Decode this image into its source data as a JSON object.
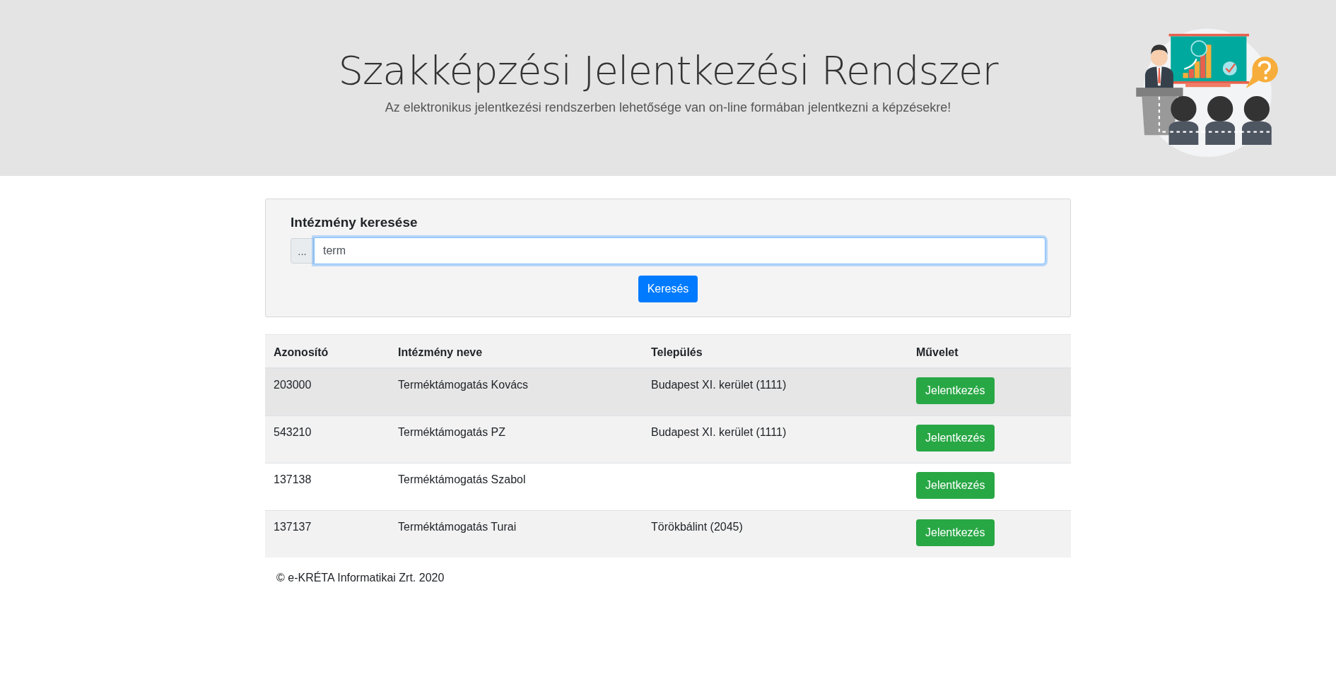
{
  "header": {
    "title": "Szakképzési Jelentkezési Rendszer",
    "subtitle": "Az elektronikus jelentkezési rendszerben lehetősége van on-line formában jelentkezni a képzésekre!"
  },
  "search": {
    "title": "Intézmény keresése",
    "addon": "...",
    "value": "term",
    "focused": true,
    "button": "Keresés"
  },
  "table": {
    "columns": [
      "Azonosító",
      "Intézmény neve",
      "Település",
      "Művelet"
    ],
    "rows": [
      {
        "id": "203000",
        "name": "Terméktámogatás Kovács",
        "city": "Budapest XI. kerület (1111)",
        "action": "Jelentkezés",
        "hovered": true
      },
      {
        "id": "543210",
        "name": "Terméktámogatás PZ",
        "city": "Budapest XI. kerület (1111)",
        "action": "Jelentkezés",
        "hovered": false
      },
      {
        "id": "137138",
        "name": "Terméktámogatás Szabol",
        "city": "",
        "action": "Jelentkezés",
        "hovered": false
      },
      {
        "id": "137137",
        "name": "Terméktámogatás Turai",
        "city": "Törökbálint (2045)",
        "action": "Jelentkezés",
        "hovered": false
      }
    ]
  },
  "footer": "© e-KRÉTA Informatikai Zrt. 2020"
}
